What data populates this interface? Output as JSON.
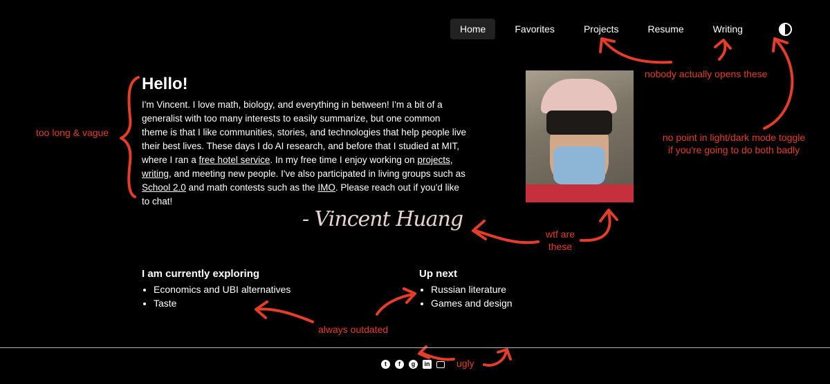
{
  "nav": {
    "items": [
      {
        "label": "Home",
        "active": true
      },
      {
        "label": "Favorites",
        "active": false
      },
      {
        "label": "Projects",
        "active": false
      },
      {
        "label": "Resume",
        "active": false
      },
      {
        "label": "Writing",
        "active": false
      }
    ],
    "theme_toggle_icon": "half-circle-contrast-icon"
  },
  "intro": {
    "title": "Hello!",
    "p1": "I'm Vincent. I love math, biology, and everything in between! I'm a bit of a generalist with too many interests to easily summarize, but one common theme is that I like communities, stories, and technologies that help people live their best lives. These days I do AI research, and before that I studied at MIT, where I ran a ",
    "link_hotel": "free hotel service",
    "p2": ". In my free time I enjoy working on ",
    "link_projects": "projects",
    "p3": ", ",
    "link_writing": "writing",
    "p4": ", and meeting new people. I've also participated in living groups such as ",
    "link_school": "School 2.0",
    "p5": " and math contests such as the ",
    "link_imo": "IMO",
    "p6": ". Please reach out if you'd like to chat!"
  },
  "signature": "- Vincent Huang",
  "exploring": {
    "heading": "I am currently exploring",
    "items": [
      "Economics and UBI alternatives",
      "Taste"
    ]
  },
  "upnext": {
    "heading": "Up next",
    "items": [
      "Russian literature",
      "Games and design"
    ]
  },
  "annotations": {
    "too_long": "too long & vague",
    "nobody_opens": "nobody actually opens these",
    "toggle_line1": "no point in light/dark mode toggle",
    "toggle_line2": "if you're going to do both badly",
    "wtf_line1": "wtf are",
    "wtf_line2": "these",
    "outdated": "always outdated",
    "ugly": "ugly"
  },
  "footer": {
    "social_icons": [
      "twitter-icon",
      "facebook-icon",
      "github-icon",
      "linkedin-icon",
      "mail-icon"
    ]
  },
  "colors": {
    "background": "#000000",
    "text": "#ffffff",
    "annotation": "#e43d2a",
    "active_nav_bg": "#222222"
  }
}
